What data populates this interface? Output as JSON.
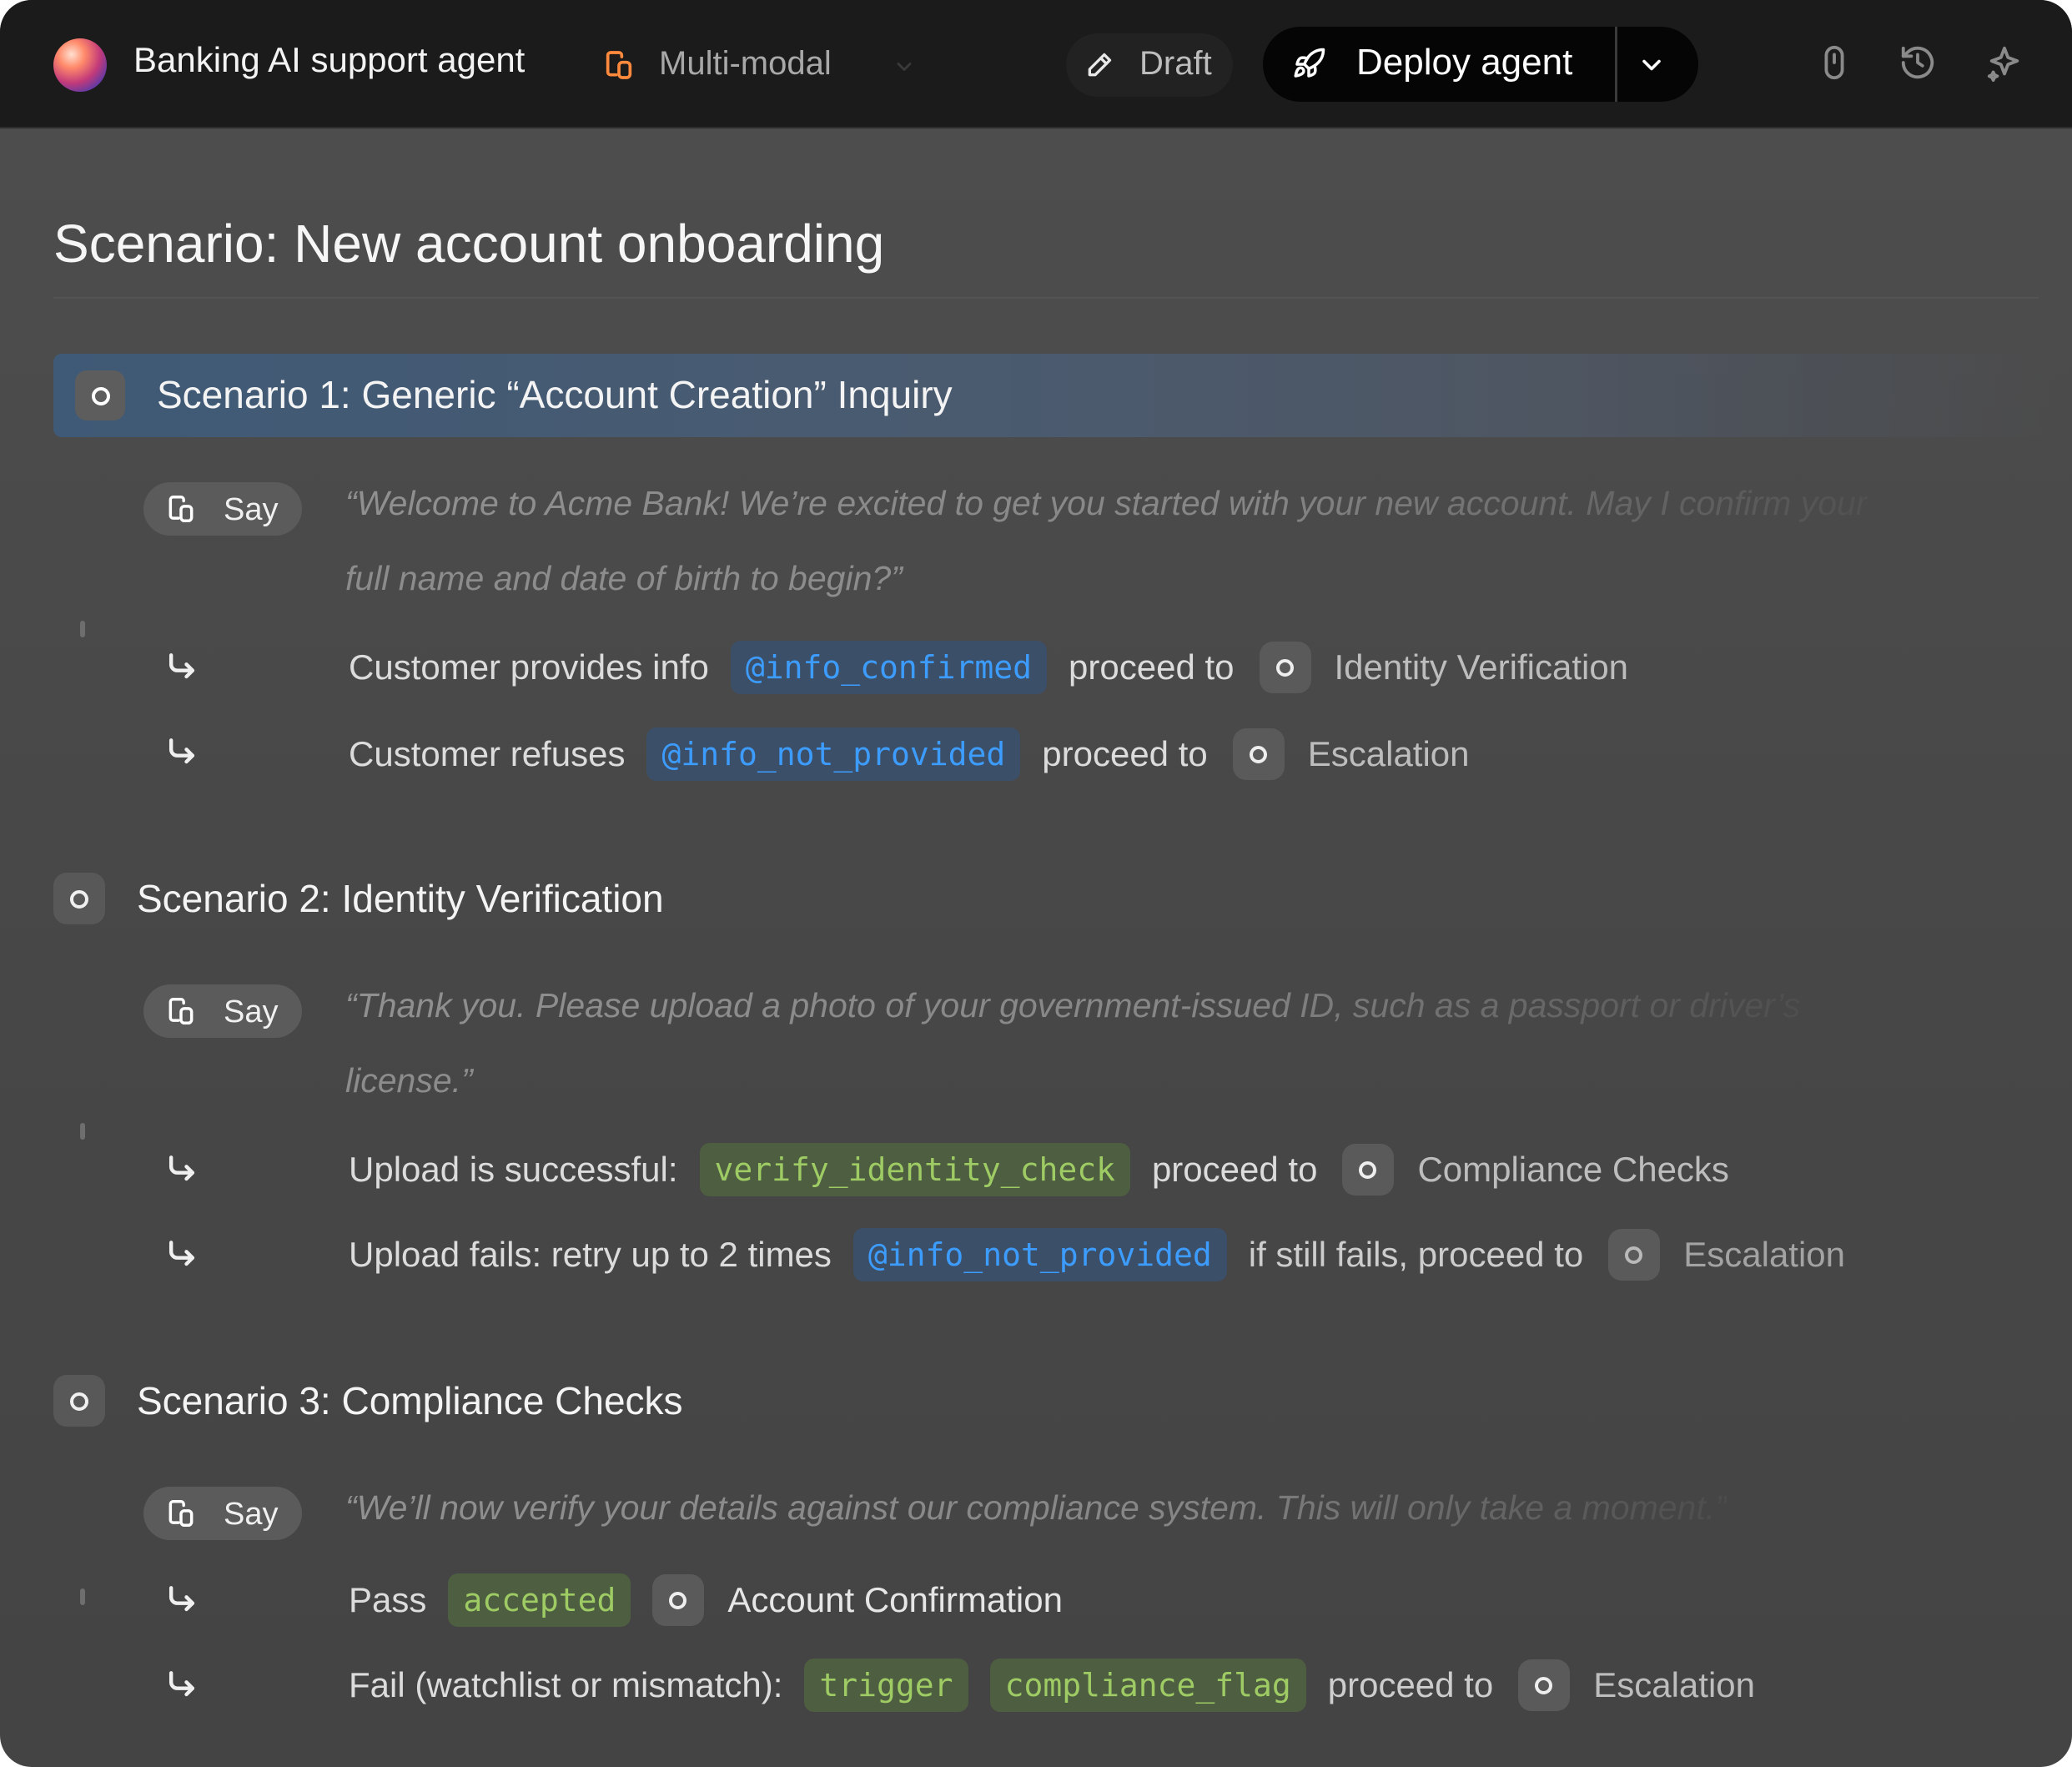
{
  "header": {
    "app_title": "Banking AI support agent",
    "mode_label": "Multi-modal",
    "draft_label": "Draft",
    "deploy_label": "Deploy agent",
    "accent_color": "#ff8a3d",
    "icons": [
      "app-orb-icon",
      "multimodal-icon",
      "chevron-down-icon",
      "pencil-icon",
      "rocket-icon",
      "touch-icon",
      "history-icon",
      "sparkle-icon"
    ]
  },
  "page": {
    "title": "Scenario: New account onboarding"
  },
  "scenarios": [
    {
      "title": "Scenario 1: Generic “Account Creation” Inquiry",
      "say_label": "Say",
      "quote_line1": "“Welcome to Acme Bank! We’re excited to get you started with your new account. May I confirm your",
      "quote_line2": "full name and date of birth to begin?”",
      "rules": [
        {
          "condition": "Customer provides info",
          "tag": "@info_confirmed",
          "action": "proceed to",
          "target": "Identity Verification"
        },
        {
          "condition": "Customer refuses",
          "tag": "@info_not_provided",
          "action": "proceed to",
          "target": "Escalation"
        }
      ]
    },
    {
      "title": "Scenario 2: Identity Verification",
      "say_label": "Say",
      "quote_line1": "“Thank you. Please upload a photo of your government-issued ID, such as a passport or driver’s",
      "quote_line2": "license.”",
      "rules": [
        {
          "condition": "Upload is successful:",
          "tag": "verify_identity_check",
          "action": "proceed to",
          "target": "Compliance Checks"
        },
        {
          "condition": "Upload fails: retry up to 2 times",
          "tag": "@info_not_provided",
          "action": "if still fails, proceed to",
          "target": "Escalation"
        }
      ]
    },
    {
      "title": "Scenario 3: Compliance Checks",
      "say_label": "Say",
      "quote_line1": "“We’ll now verify your details against our compliance system. This will only take a moment.”",
      "rules": [
        {
          "condition": "Pass",
          "tag": "accepted",
          "target": "Account Confirmation"
        },
        {
          "condition": "Fail (watchlist or mismatch):",
          "tag": "trigger",
          "tag2": "compliance_flag",
          "action": "proceed to",
          "target": "Escalation"
        }
      ]
    }
  ],
  "colors": {
    "topbar_bg": "#1b1b1b",
    "content_bg": "#4a4a4a",
    "event_chip_text": "#3d9cff",
    "event_chip_bg": "#3b5068",
    "tool_chip_text": "#9ecb64",
    "tool_chip_bg": "#4e5e40",
    "highlight_bg": "#3f5a76"
  }
}
